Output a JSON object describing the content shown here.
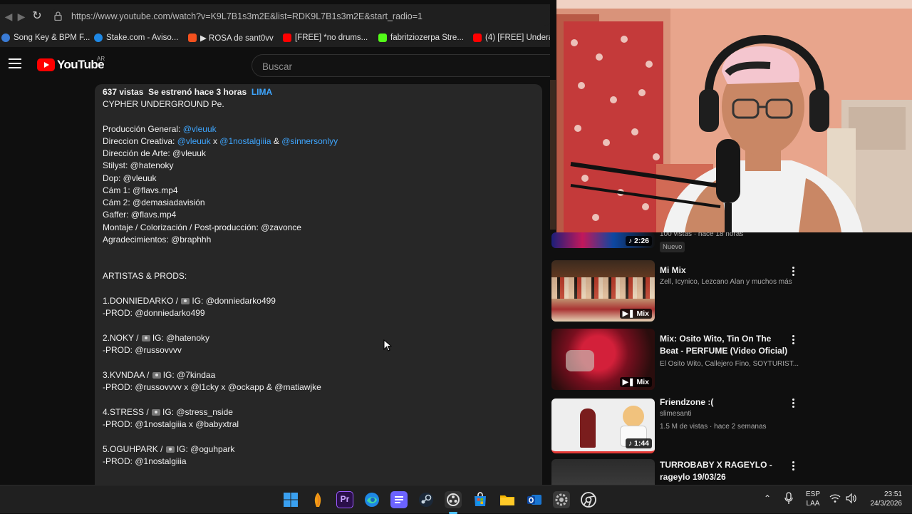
{
  "browser": {
    "url": "https://www.youtube.com/watch?v=K9L7B1s3m2E&list=RDK9L7B1s3m2E&start_radio=1",
    "bookmarks": [
      {
        "label": "Song Key & BPM F...",
        "color": "#3a7bd5"
      },
      {
        "label": "Stake.com - Aviso...",
        "color": "#1e88e5"
      },
      {
        "label": "▶ ROSA de sant0vv",
        "color": "#f4511e"
      },
      {
        "label": "[FREE] *no drums...",
        "color": "#ff0000"
      },
      {
        "label": "fabritziozerpa Stre...",
        "color": "#53fc18"
      },
      {
        "label": "(4) [FREE] Undera...",
        "color": "#ff0000"
      }
    ]
  },
  "youtube": {
    "logo_text": "YouTube",
    "country_code": "AR",
    "search_placeholder": "Buscar"
  },
  "description": {
    "views": "637 vistas",
    "premiered": "Se estrenó hace 3 horas",
    "location": "LIMA",
    "title_line": "CYPHER UNDERGROUND Pe.",
    "prod_general_label": "Producción General:",
    "prod_general_link": "@vleuuk",
    "creative_label": "Direccion Creativa:",
    "creative_link1": "@vleuuk",
    "creative_x": "x",
    "creative_link2": "@1nostalgiiia",
    "creative_amp": "&",
    "creative_link3": "@sinnersonlyy",
    "credits": [
      "Dirección de Arte: @vleuuk",
      "Stilyst: @hatenoky",
      "Dop: @vleuuk",
      "Cám 1: @flavs.mp4",
      "Cám 2: @demasiadavisión",
      "Gaffer: @flavs.mp4",
      "Montaje / Colorización / Post-producción: @zavonce",
      "Agradecimientos: @braphhh"
    ],
    "artists_header": "ARTISTAS & PRODS:",
    "artists": [
      {
        "line1_pre": "1.DONNIEDARKO /",
        "line1_post": "IG: @donniedarko499",
        "line2": "-PROD: @donniedarko499"
      },
      {
        "line1_pre": "2.NOKY /",
        "line1_post": "IG: @hatenoky",
        "line2": "-PROD: @russovvvv"
      },
      {
        "line1_pre": "3.KVNDAA /",
        "line1_post": "IG: @7kindaa",
        "line2": "-PROD: @russovvvv x @l1cky x @ockapp & @matiawjke"
      },
      {
        "line1_pre": "4.STRESS /",
        "line1_post": "IG: @stress_nside",
        "line2": "-PROD: @1nostalgiiia x @babyxtral"
      },
      {
        "line1_pre": "5.OGUHPARK /",
        "line1_post": "IG: @oguhpark",
        "line2": "-PROD: @1nostalgiiia"
      }
    ]
  },
  "related": [
    {
      "title": "",
      "meta": "100 vistas · hace 18 horas",
      "badge": "Nuevo",
      "duration": "2:26"
    },
    {
      "title": "Mi Mix",
      "meta": "Zell, Icynico, Lezcano Alan y muchos más",
      "duration": "Mix"
    },
    {
      "title": "Mix: Osito Wito, Tin On The Beat - PERFUME (Video Oficial)",
      "meta": "El Osito Wito, Callejero Fino, SOYTURIST...",
      "duration": "Mix"
    },
    {
      "title": "Friendzone :(",
      "channel": "slimesanti",
      "meta": "1.5 M de vistas · hace 2 semanas",
      "duration": "1:44"
    },
    {
      "title": "TURROBABY X RAGEYLO - rageylo 19/03/26",
      "meta": ""
    }
  ],
  "taskbar": {
    "lang_top": "ESP",
    "lang_bottom": "LAA",
    "time": "23:51",
    "date": "24/3/2026"
  }
}
